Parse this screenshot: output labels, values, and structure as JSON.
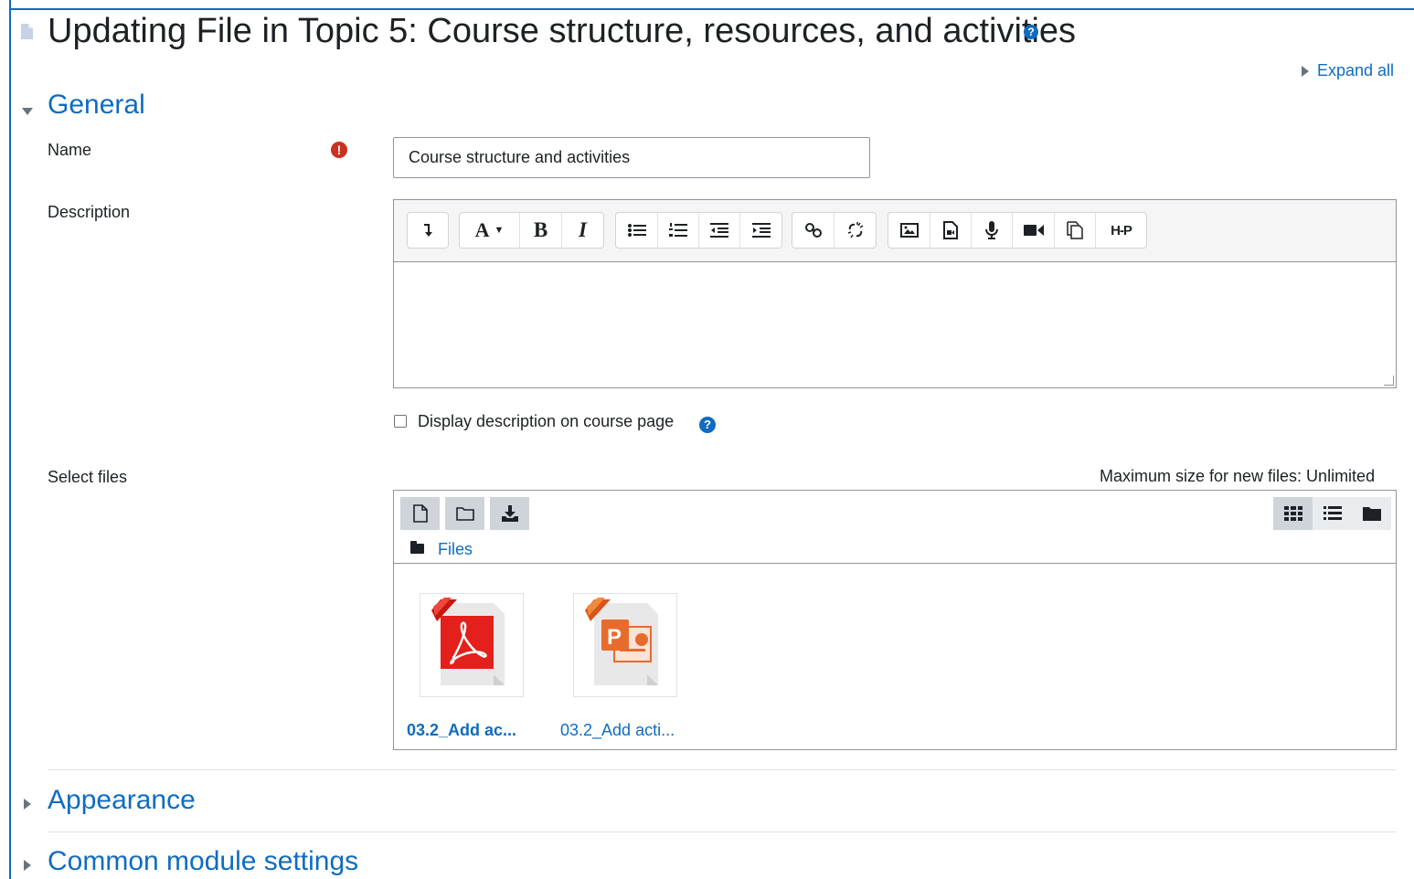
{
  "page": {
    "title": "Updating File in Topic 5: Course structure, resources, and activities",
    "help_icon": "question-circle-icon",
    "expand_all": "Expand all"
  },
  "sections": {
    "general": "General",
    "appearance": "Appearance",
    "common": "Common module settings"
  },
  "form": {
    "name_label": "Name",
    "name_value": "Course structure and activities",
    "required_icon": "exclamation-circle-icon",
    "description_label": "Description",
    "display_description": "Display description on course page",
    "display_description_checked": false,
    "select_files_label": "Select files",
    "max_size": "Maximum size for new files: Unlimited"
  },
  "editor": {
    "toolbar_icons": [
      "toggle-toolbar-icon",
      "font-style-icon",
      "bold-icon",
      "italic-icon",
      "bullet-list-icon",
      "numbered-list-icon",
      "outdent-icon",
      "indent-icon",
      "link-icon",
      "unlink-icon",
      "image-icon",
      "media-icon",
      "microphone-icon",
      "video-icon",
      "copy-icon",
      "h5p-icon"
    ],
    "bold": "B",
    "italic": "I",
    "font": "A",
    "h5p": "H-P",
    "content": ""
  },
  "filepicker": {
    "breadcrumb": "Files",
    "files": [
      {
        "name": "03.2_Add ac...",
        "type": "pdf",
        "selected": true
      },
      {
        "name": "03.2_Add acti...",
        "type": "pptx",
        "selected": false
      }
    ]
  },
  "colors": {
    "accent": "#0f6cbf",
    "required": "#ca3120",
    "pdf": "#e3201b",
    "ppt": "#e86b2e"
  }
}
